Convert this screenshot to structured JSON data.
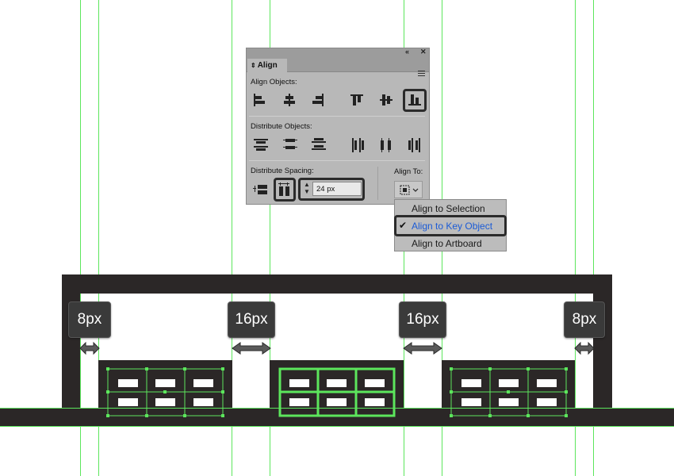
{
  "align_panel": {
    "tab_label": "Align",
    "collapse_icon": "double-chevron-left-icon",
    "close_icon": "close-icon",
    "menu_icon": "panel-menu-icon",
    "align_objects_label": "Align Objects:",
    "distribute_objects_label": "Distribute Objects:",
    "distribute_spacing_label": "Distribute Spacing:",
    "align_to_label": "Align To:",
    "spacing_value": "24 px",
    "highlighted_buttons": [
      "vertical-align-bottom",
      "vertical-distribute-space",
      "spacing-value"
    ]
  },
  "align_to_menu": {
    "items": [
      {
        "label": "Align to Selection",
        "selected": false
      },
      {
        "label": "Align to Key Object",
        "selected": true
      },
      {
        "label": "Align to Artboard",
        "selected": false
      }
    ],
    "selected_color": "#1b5bd6"
  },
  "measurements": [
    "8px",
    "16px",
    "16px",
    "8px"
  ],
  "colors": {
    "guide": "#5ce65c",
    "shape": "#2b2727",
    "window_fill": "#ffffff"
  }
}
